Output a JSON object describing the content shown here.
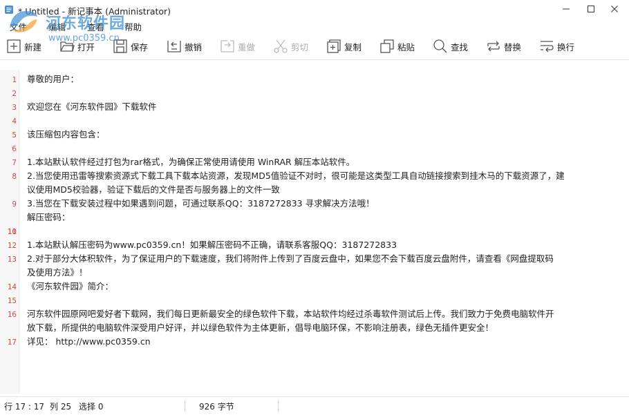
{
  "window": {
    "title": "* Untitled - 新记事本 (Administrator)",
    "min_glyph": "—",
    "max_glyph": "☐",
    "close_glyph": "✕"
  },
  "watermark": {
    "title": "河东软件园",
    "url": "www.pc0359.cn"
  },
  "menu": [
    "文件",
    "编辑",
    "查看",
    "帮助"
  ],
  "toolbar": [
    {
      "label": "新建",
      "icon": "new-file-icon",
      "enabled": true
    },
    {
      "label": "打开",
      "icon": "folder-open-icon",
      "enabled": true
    },
    {
      "label": "保存",
      "icon": "save-icon",
      "enabled": true
    },
    {
      "label": "撤销",
      "icon": "undo-icon",
      "enabled": true
    },
    {
      "label": "重做",
      "icon": "redo-icon",
      "enabled": false
    },
    {
      "label": "剪切",
      "icon": "scissors-icon",
      "enabled": false
    },
    {
      "label": "复制",
      "icon": "copy-icon",
      "enabled": true
    },
    {
      "label": "粘贴",
      "icon": "paste-icon",
      "enabled": true
    },
    {
      "label": "查找",
      "icon": "search-icon",
      "enabled": true
    },
    {
      "label": "替换",
      "icon": "replace-icon",
      "enabled": true
    },
    {
      "label": "换行",
      "icon": "wrap-icon",
      "enabled": true
    }
  ],
  "lines": [
    {
      "n": "1",
      "text": [
        "尊敬的用户："
      ]
    },
    {
      "n": "2",
      "text": [
        ""
      ]
    },
    {
      "n": "3",
      "text": [
        "欢迎您在《河东软件园》下载软件"
      ]
    },
    {
      "n": "4",
      "text": [
        ""
      ]
    },
    {
      "n": "5",
      "text": [
        "该压缩包内容包含："
      ]
    },
    {
      "n": "6",
      "text": [
        ""
      ]
    },
    {
      "n": "7",
      "text": [
        "1.本站默认软件经过打包为rar格式，为确保正常使用请使用 WinRAR 解压本站软件。"
      ]
    },
    {
      "n": "8",
      "text": [
        "2.当您使用迅雷等搜索资源式下载工具下载本站资源，发现MD5值验证不对时，很可能是这类型工具自动链接搜索到挂木马的下载资源了，建",
        "议使用MD5校验器，验证下载后的文件是否与服务器上的文件一致"
      ]
    },
    {
      "n": "9",
      "text": [
        "3.当您在下载安装过程中如果遇到问题，可通过联系QQ：3187272833 寻求解决方法哦！",
        "解压密码："
      ]
    },
    {
      "n": "10",
      "text": [
        ""
      ]
    },
    {
      "n": "11",
      "text": [
        ""
      ]
    },
    {
      "n": "12",
      "text": [
        "1.本站默认解压密码为www.pc0359.cn！如果解压密码不正确，请联系客服QQ：3187272833"
      ]
    },
    {
      "n": "13",
      "text": [
        "2.对于部分大体积软件，为了保证用户的下载速度，我们将附件上传到了百度云盘中，如果您不会下载百度云盘附件，请查看《网盘提取码",
        "及使用方法》！",
        "《河东软件园》简介："
      ]
    },
    {
      "n": "14",
      "text": [
        ""
      ]
    },
    {
      "n": "15",
      "text": [
        ""
      ]
    },
    {
      "n": "16",
      "text": [
        "河东软件园原网吧爱好者下载网，我们每日更新最安全的绿色软件下载，本站软件均经过杀毒软件测试后上传。我们致力于免费电脑软件开",
        "放下载，所提供的电脑软件深受用户好评，并以绿色软件为主体更新，倡导电脑环保，不影响注册表，绿色无插件更安全！"
      ]
    },
    {
      "n": "17",
      "text": [
        "详见： http://www.pc0359.cn"
      ]
    }
  ],
  "status": {
    "row": "行 17 : 17",
    "col": "列 25",
    "sel": "选择 0",
    "bytes": "926 字节"
  }
}
